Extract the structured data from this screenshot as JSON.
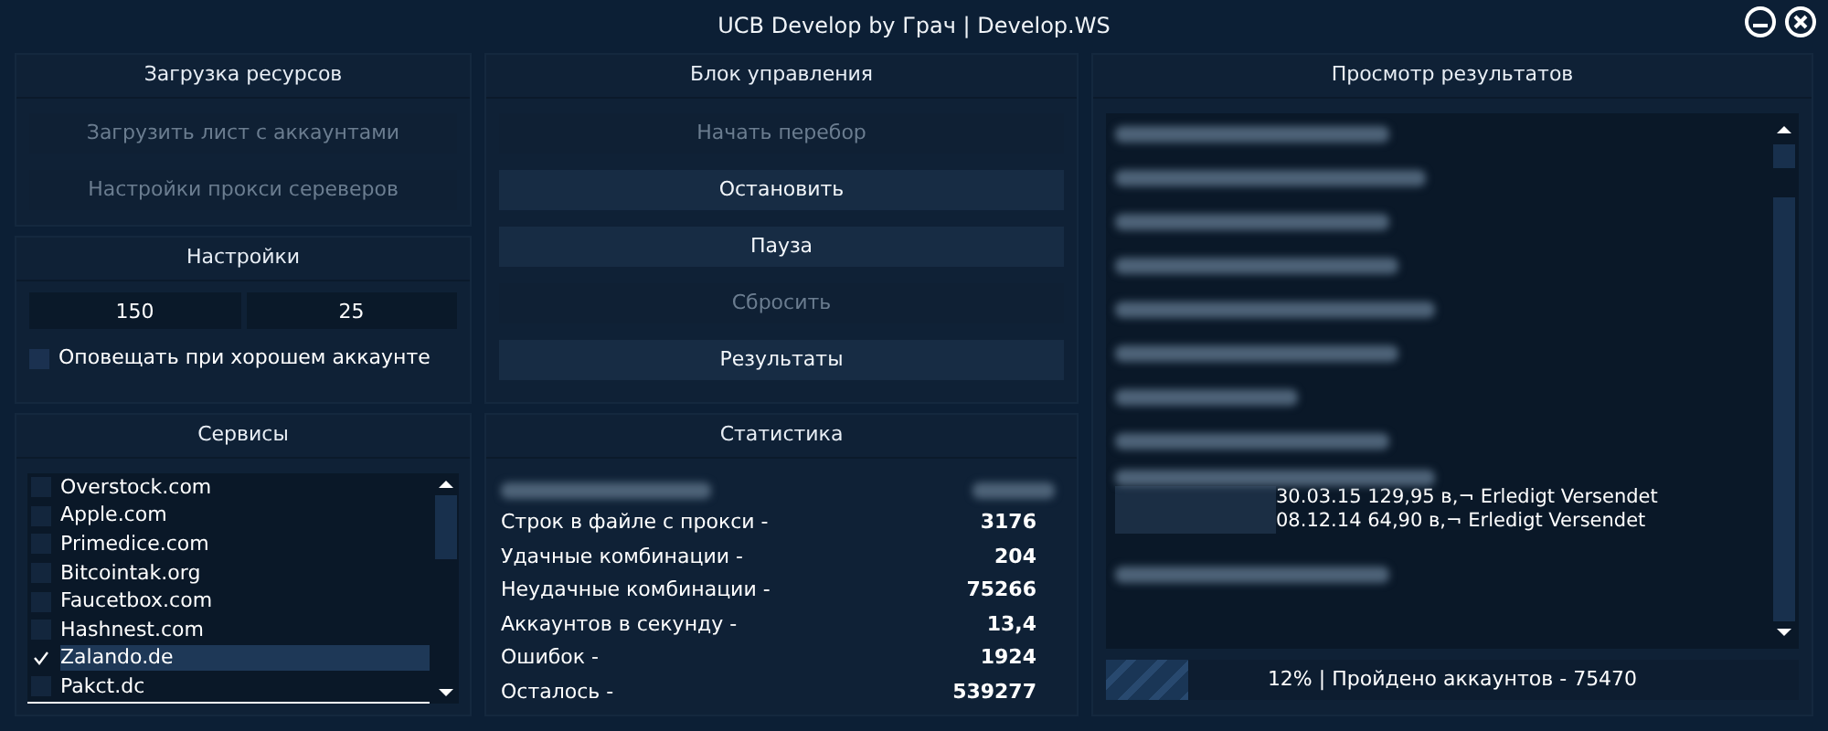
{
  "window": {
    "title": "UCB Develop by Грач | Develop.WS"
  },
  "resources": {
    "title": "Загрузка ресурсов",
    "buttons": [
      {
        "label": "Загрузить лист с аккаунтами",
        "disabled": true
      },
      {
        "label": "Настройки прокси сереверов",
        "disabled": true
      }
    ]
  },
  "settings": {
    "title": "Настройки",
    "fields": [
      {
        "value": "150"
      },
      {
        "value": "25"
      }
    ],
    "notify": {
      "label": "Оповещать при хорошем аккаунте",
      "checked": false
    }
  },
  "control": {
    "title": "Блок управления",
    "buttons": [
      {
        "label": "Начать перебор",
        "disabled": true
      },
      {
        "label": "Остановить",
        "disabled": false
      },
      {
        "label": "Пауза",
        "disabled": false
      },
      {
        "label": "Сбросить",
        "disabled": true
      },
      {
        "label": "Результаты",
        "disabled": false
      }
    ]
  },
  "services": {
    "title": "Сервисы",
    "items": [
      {
        "label": "Overstock.com",
        "checked": false,
        "selected": false
      },
      {
        "label": "Apple.com",
        "checked": false,
        "selected": false
      },
      {
        "label": "Primedice.com",
        "checked": false,
        "selected": false
      },
      {
        "label": "Bitcointak.org",
        "checked": false,
        "selected": false
      },
      {
        "label": "Faucetbox.com",
        "checked": false,
        "selected": false
      },
      {
        "label": "Hashnest.com",
        "checked": false,
        "selected": false
      },
      {
        "label": "Zalando.de",
        "checked": true,
        "selected": true
      },
      {
        "label": "Pakct.dc",
        "checked": false,
        "selected": false
      }
    ]
  },
  "statistics": {
    "title": "Статистика",
    "rows": [
      {
        "label": "Строк в файле с прокси -",
        "value": "3176"
      },
      {
        "label": "Удачные комбинации -",
        "value": "204"
      },
      {
        "label": "Неудачные комбинации -",
        "value": "75266"
      },
      {
        "label": "Аккаунтов в секунду -",
        "value": "13,4"
      },
      {
        "label": "Ошибок -",
        "value": "1924"
      },
      {
        "label": "Осталось -",
        "value": "539277"
      }
    ]
  },
  "results": {
    "title": "Просмотр результатов",
    "lines": [
      "30.03.15 129,95 в,¬ Erledigt Versendet",
      "08.12.14 64,90 в,¬ Erledigt Versendet"
    ],
    "progress": {
      "level": 0.12,
      "label": "12% | Пройдено аккаунтов - 75470"
    }
  }
}
